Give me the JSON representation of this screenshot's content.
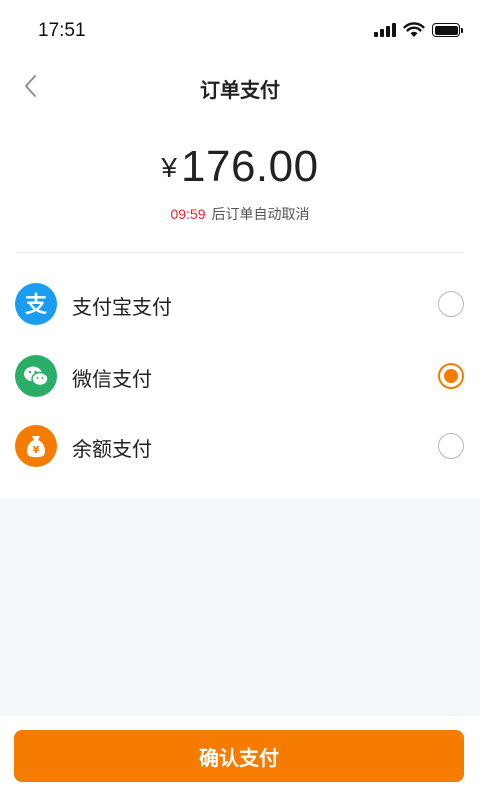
{
  "status_bar": {
    "time": "17:51"
  },
  "nav": {
    "title": "订单支付"
  },
  "order": {
    "currency": "¥",
    "amount": "176.00",
    "countdown": "09:59",
    "countdown_suffix": "后订单自动取消"
  },
  "payment_methods": [
    {
      "label": "支付宝支付",
      "icon": "alipay-icon",
      "color": "#1677ff",
      "selected": false
    },
    {
      "label": "微信支付",
      "icon": "wechat-icon",
      "color": "#2aae67",
      "selected": true
    },
    {
      "label": "余额支付",
      "icon": "money-bag-icon",
      "color": "#f57c00",
      "selected": false
    }
  ],
  "footer": {
    "confirm_label": "确认支付"
  },
  "colors": {
    "accent": "#f57c00",
    "countdown": "#e8242b",
    "background_grey": "#f4f7f9"
  }
}
